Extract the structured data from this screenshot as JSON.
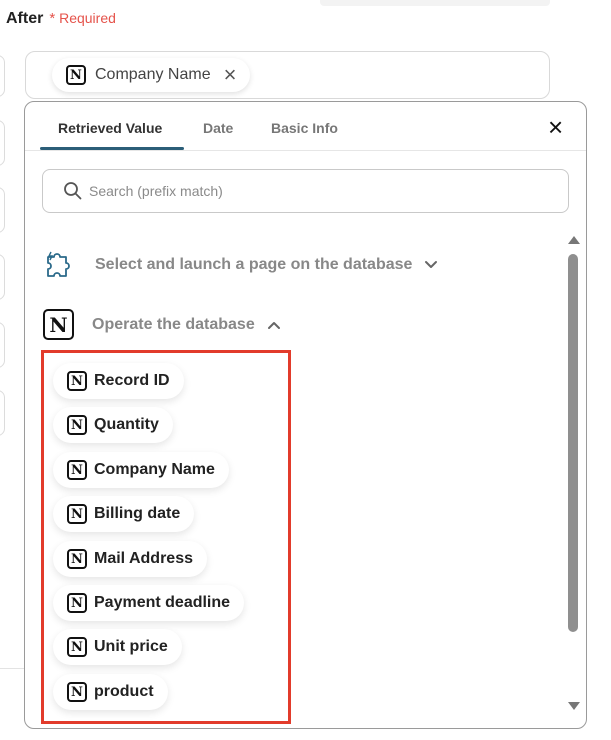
{
  "header": {
    "title": "After",
    "required_star": "*",
    "required_label": "Required"
  },
  "field": {
    "chip_label": "Company Name",
    "remove_symbol": "×"
  },
  "tabs": [
    {
      "label": "Retrieved Value",
      "active": true
    },
    {
      "label": "Date",
      "active": false
    },
    {
      "label": "Basic Info",
      "active": false
    }
  ],
  "close_symbol": "×",
  "search": {
    "placeholder": "Search (prefix match)",
    "value": ""
  },
  "sections": [
    {
      "label": "Select and launch a page on the database",
      "icon": "puzzle-icon",
      "expanded": false
    },
    {
      "label": "Operate the database",
      "icon": "notion-icon",
      "expanded": true
    }
  ],
  "items": [
    {
      "label": "Record ID",
      "icon": "notion-icon"
    },
    {
      "label": "Quantity",
      "icon": "notion-icon"
    },
    {
      "label": "Company Name",
      "icon": "notion-icon"
    },
    {
      "label": "Billing date",
      "icon": "notion-icon"
    },
    {
      "label": "Mail Address",
      "icon": "notion-icon"
    },
    {
      "label": "Payment deadline",
      "icon": "notion-icon"
    },
    {
      "label": "Unit price",
      "icon": "notion-icon"
    },
    {
      "label": "product",
      "icon": "notion-icon"
    }
  ],
  "colors": {
    "accent_tab": "#2b5e78",
    "highlight": "#e23b2b",
    "required": "#e5534b"
  }
}
